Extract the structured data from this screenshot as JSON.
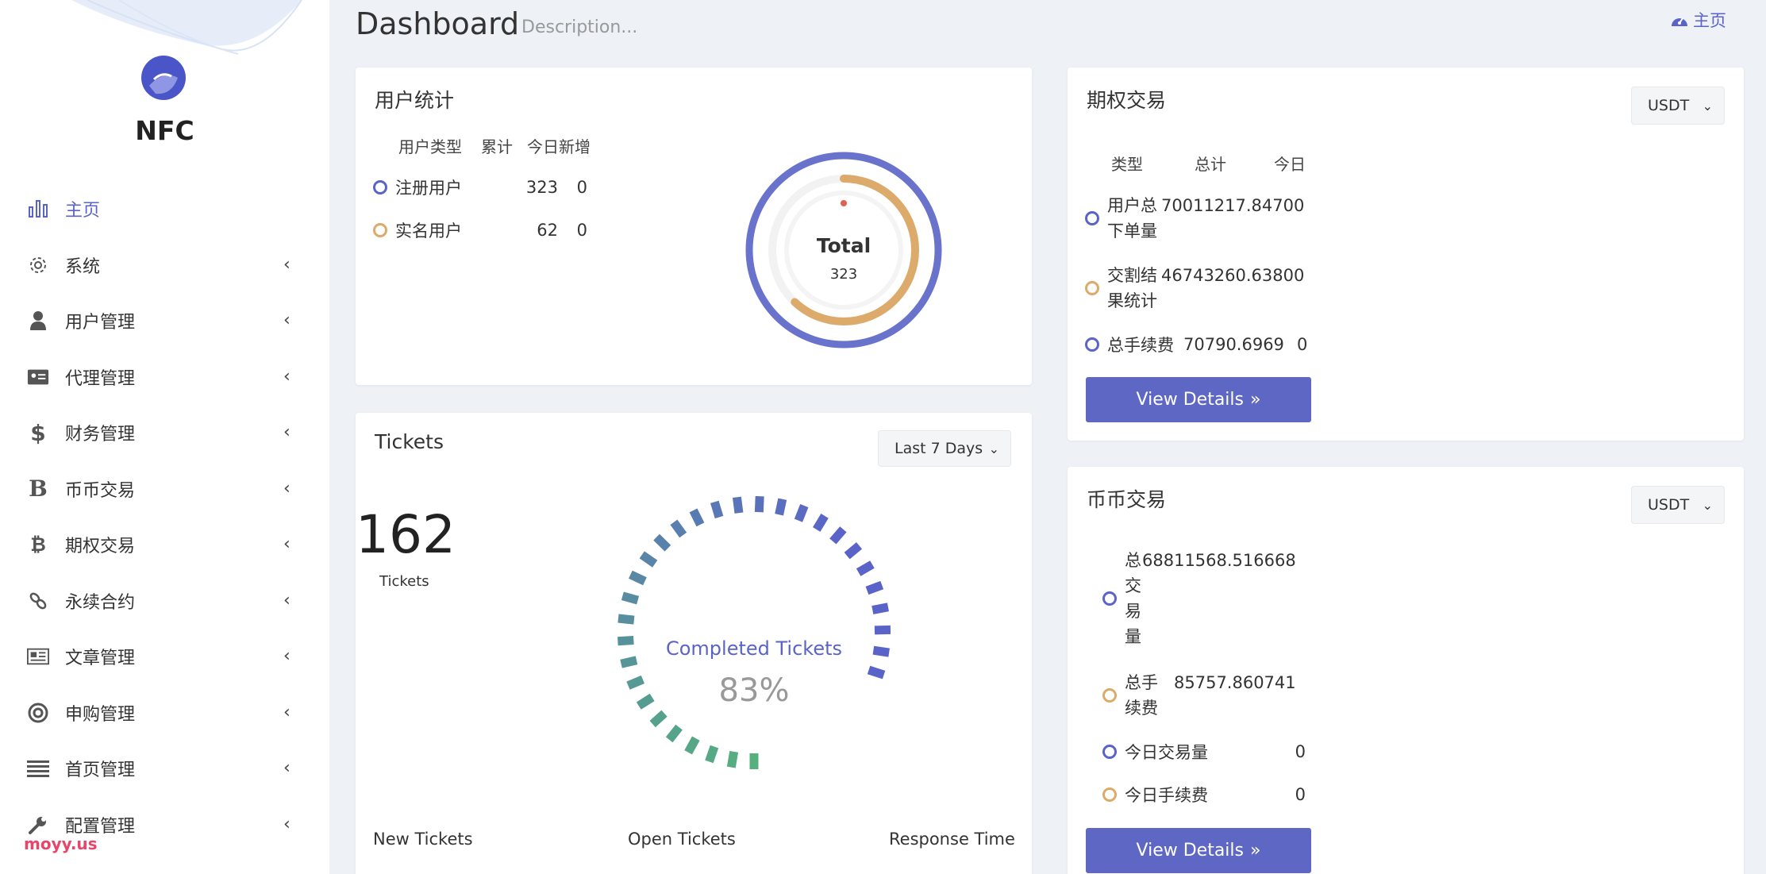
{
  "brand": {
    "name": "NFC"
  },
  "header": {
    "title": "Dashboard",
    "description": "Description...",
    "breadcrumb": "主页"
  },
  "sidebar": {
    "items": [
      {
        "label": "主页",
        "icon": "bar-chart-icon",
        "active": true
      },
      {
        "label": "系统",
        "icon": "gear-icon"
      },
      {
        "label": "用户管理",
        "icon": "user-icon"
      },
      {
        "label": "代理管理",
        "icon": "id-card-icon"
      },
      {
        "label": "财务管理",
        "icon": "dollar-icon"
      },
      {
        "label": "币币交易",
        "icon": "b-letter-icon"
      },
      {
        "label": "期权交易",
        "icon": "bitcoin-icon"
      },
      {
        "label": "永续合约",
        "icon": "link-icon"
      },
      {
        "label": "文章管理",
        "icon": "newspaper-icon"
      },
      {
        "label": "申购管理",
        "icon": "lifebuoy-icon"
      },
      {
        "label": "首页管理",
        "icon": "list-icon"
      },
      {
        "label": "配置管理",
        "icon": "wrench-icon"
      }
    ],
    "watermark": "moyy.us"
  },
  "user_stats": {
    "title": "用户统计",
    "headers": [
      "用户类型",
      "累计",
      "今日新增"
    ],
    "rows": [
      {
        "type": "注册用户",
        "total": "323",
        "today": "0"
      },
      {
        "type": "实名用户",
        "total": "62",
        "today": "0"
      }
    ],
    "donut": {
      "label": "Total",
      "value": "323",
      "outer_percent": 100,
      "inner_percent": 62
    }
  },
  "tickets": {
    "title": "Tickets",
    "range": "Last 7 Days",
    "count": "162",
    "count_label": "Tickets",
    "gauge_label": "Completed Tickets",
    "gauge_value": "83%",
    "gauge_percent": 83,
    "footer": [
      "New Tickets",
      "Open Tickets",
      "Response Time"
    ]
  },
  "options": {
    "title": "期权交易",
    "currency": "USDT",
    "headers": [
      "类型",
      "总计",
      "今日"
    ],
    "rows": [
      {
        "type_l1": "用户总",
        "type_l2": "下单量",
        "total": "70011217.84700",
        "today": ""
      },
      {
        "type_l1": "交割结",
        "type_l2": "果统计",
        "total": "46743260.63800",
        "today": ""
      },
      {
        "type_l1": "总手续费",
        "type_l2": "",
        "total": "70790.6969",
        "today": "0"
      }
    ],
    "button": "View Details"
  },
  "spot": {
    "title": "币币交易",
    "currency": "USDT",
    "rows": [
      {
        "label_lines": [
          "总",
          "交",
          "易",
          "量"
        ],
        "total": "68811568.516668",
        "today": ""
      },
      {
        "label_lines": [
          "总手",
          "续费"
        ],
        "total": "85757.860741",
        "today": ""
      },
      {
        "label_lines": [
          "今日交易量"
        ],
        "total": "",
        "today": "0"
      },
      {
        "label_lines": [
          "今日手续费"
        ],
        "total": "",
        "today": "0"
      }
    ],
    "button": "View Details"
  },
  "colors": {
    "accent": "#5f67c4",
    "gold": "#dcaa6a",
    "green": "#55b07e",
    "blue": "#5a64c8"
  }
}
